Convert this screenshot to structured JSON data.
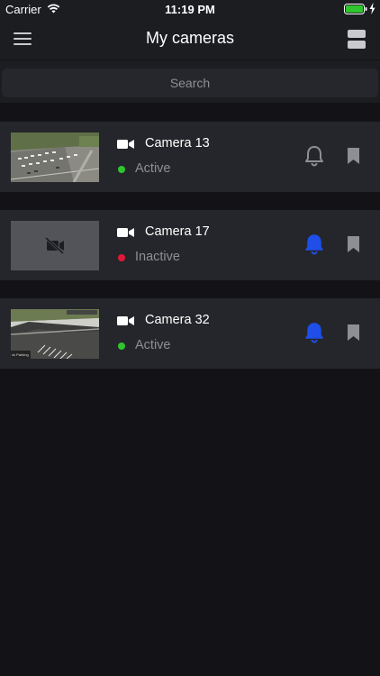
{
  "status_bar": {
    "carrier": "Carrier",
    "time": "11:19 PM"
  },
  "nav": {
    "title": "My cameras",
    "menu_icon": "hamburger-menu-icon",
    "layout_icon": "layout-toggle-icon"
  },
  "search": {
    "placeholder": "Search"
  },
  "colors": {
    "active": "#2fc52f",
    "inactive": "#e0193a",
    "bell_on": "#1f4fe8",
    "bell_off": "#8e8f94"
  },
  "cameras": [
    {
      "name": "Camera 13",
      "status": "Active",
      "alerts_enabled": false,
      "thumbnail": "parking-lot-aerial"
    },
    {
      "name": "Camera 17",
      "status": "Inactive",
      "alerts_enabled": true,
      "thumbnail": "video-off-placeholder"
    },
    {
      "name": "Camera 32",
      "status": "Active",
      "alerts_enabled": true,
      "thumbnail": "parking-lot-ground"
    }
  ]
}
